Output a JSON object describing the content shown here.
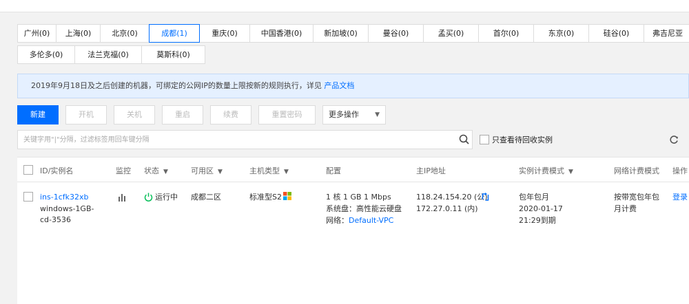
{
  "regions": {
    "row1": [
      {
        "label": "广州(0)",
        "active": false
      },
      {
        "label": "上海(0)",
        "active": false
      },
      {
        "label": "北京(0)",
        "active": false
      },
      {
        "label": "成都(1)",
        "active": true
      },
      {
        "label": "重庆(0)",
        "active": false
      },
      {
        "label": "中国香港(0)",
        "active": false
      },
      {
        "label": "新加坡(0)",
        "active": false
      },
      {
        "label": "曼谷(0)",
        "active": false
      },
      {
        "label": "孟买(0)",
        "active": false
      },
      {
        "label": "首尔(0)",
        "active": false
      },
      {
        "label": "东京(0)",
        "active": false
      },
      {
        "label": "硅谷(0)",
        "active": false
      },
      {
        "label": "弗吉尼亚",
        "active": false
      }
    ],
    "row2": [
      {
        "label": "多伦多(0)",
        "active": false
      },
      {
        "label": "法兰克福(0)",
        "active": false
      },
      {
        "label": "莫斯科(0)",
        "active": false
      }
    ]
  },
  "notice": {
    "text": "2019年9月18日及之后创建的机器，可绑定的公网IP的数量上限按新的规则执行，详见",
    "link": "产品文档"
  },
  "toolbar": {
    "new": "新建",
    "start": "开机",
    "stop": "关机",
    "restart": "重启",
    "renew": "续费",
    "reset_password": "重置密码",
    "more": "更多操作"
  },
  "search": {
    "placeholder": "关键字用\"|\"分隔，过滤标签用回车键分隔",
    "recycle_label": "只查看待回收实例"
  },
  "table": {
    "headers": {
      "id": "ID/实例名",
      "monitor": "监控",
      "status": "状态",
      "zone": "可用区",
      "type": "主机类型",
      "config": "配置",
      "ip": "主IP地址",
      "billing": "实例计费模式",
      "net_billing": "网络计费模式",
      "ops": "操作"
    },
    "row": {
      "id": "ins-1cfk32xb",
      "name1": "windows-1GB-",
      "name2": "cd-3536",
      "status": "运行中",
      "zone": "成都二区",
      "type": "标准型S2",
      "config1": "1 核 1 GB 1 Mbps",
      "config2": "系统盘：高性能云硬盘",
      "network_label": "网络：",
      "network_value": "Default-VPC",
      "ip_public": "118.24.154.20 (公)",
      "ip_private": "172.27.0.11 (内)",
      "billing1": "包年包月",
      "billing2": "2020-01-17",
      "billing3": "21:29到期",
      "net_billing1": "按带宽包年包",
      "net_billing2": "月计费",
      "op": "登录"
    }
  },
  "colors": {
    "accent": "#006eff",
    "running": "#0abf5b"
  }
}
